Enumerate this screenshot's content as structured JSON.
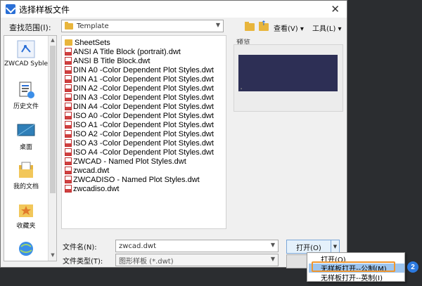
{
  "window": {
    "title": "选择样板文件"
  },
  "lookin": {
    "label": "查找范围(I):",
    "value": "Template"
  },
  "toolbar": {
    "views_label": "查看(V)",
    "tools_label": "工具(L)"
  },
  "places": [
    {
      "label": "ZWCAD Syble"
    },
    {
      "label": "历史文件"
    },
    {
      "label": "桌面"
    },
    {
      "label": "我的文档"
    },
    {
      "label": "收藏夹"
    }
  ],
  "files": [
    {
      "name": "SheetSets",
      "kind": "folder"
    },
    {
      "name": "ANSI A Title Block (portrait).dwt",
      "kind": "dwt"
    },
    {
      "name": "ANSI B Title Block.dwt",
      "kind": "dwt"
    },
    {
      "name": "DIN A0 -Color Dependent Plot Styles.dwt",
      "kind": "dwt"
    },
    {
      "name": "DIN A1 -Color Dependent Plot Styles.dwt",
      "kind": "dwt"
    },
    {
      "name": "DIN A2 -Color Dependent Plot Styles.dwt",
      "kind": "dwt"
    },
    {
      "name": "DIN A3 -Color Dependent Plot Styles.dwt",
      "kind": "dwt"
    },
    {
      "name": "DIN A4 -Color Dependent Plot Styles.dwt",
      "kind": "dwt"
    },
    {
      "name": "ISO A0 -Color Dependent Plot Styles.dwt",
      "kind": "dwt"
    },
    {
      "name": "ISO A1 -Color Dependent Plot Styles.dwt",
      "kind": "dwt"
    },
    {
      "name": "ISO A2 -Color Dependent Plot Styles.dwt",
      "kind": "dwt"
    },
    {
      "name": "ISO A3 -Color Dependent Plot Styles.dwt",
      "kind": "dwt"
    },
    {
      "name": "ISO A4 -Color Dependent Plot Styles.dwt",
      "kind": "dwt"
    },
    {
      "name": "ZWCAD - Named Plot Styles.dwt",
      "kind": "dwt"
    },
    {
      "name": "zwcad.dwt",
      "kind": "dwt"
    },
    {
      "name": "ZWCADISO - Named Plot Styles.dwt",
      "kind": "dwt"
    },
    {
      "name": "zwcadiso.dwt",
      "kind": "dwt"
    }
  ],
  "preview": {
    "label": "预览"
  },
  "filename": {
    "label": "文件名(N):",
    "value": "zwcad.dwt"
  },
  "filetype": {
    "label": "文件类型(T):",
    "value": "图形样板 (*.dwt)"
  },
  "buttons": {
    "open_label": "打开(O)"
  },
  "open_menu": [
    {
      "label": "打开(O)"
    },
    {
      "label": "无样板打开--公制(M)"
    },
    {
      "label": "无样板打开--英制(I)"
    }
  ],
  "badge": {
    "number": "2"
  },
  "colors": {
    "highlight": "#9ec5ee",
    "callout": "#f0962e",
    "badge": "#2c7ae0"
  }
}
